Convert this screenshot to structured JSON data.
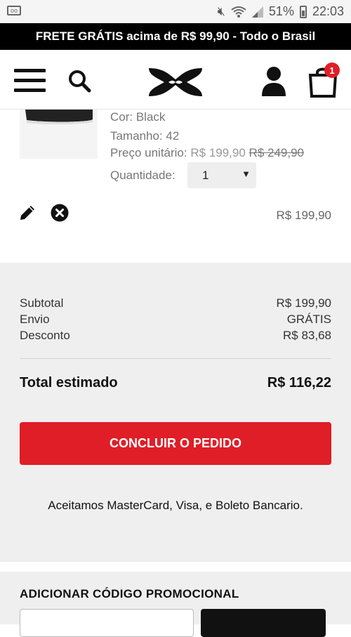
{
  "status_bar": {
    "battery_percent": "51%",
    "time": "22:03"
  },
  "promo_banner": {
    "text": "FRETE GRÁTIS acima de R$ 99,90 - Todo o Brasil"
  },
  "header": {
    "cart_count": "1"
  },
  "product": {
    "color": "Cor: Black",
    "size": "Tamanho: 42",
    "unit_price_label": "Preço unitário:",
    "unit_price": "R$ 199,90",
    "original_price": "R$ 249,90",
    "quantity_label": "Quantidade:",
    "quantity_value": "1",
    "line_total": "R$ 199,90"
  },
  "summary": {
    "subtotal_label": "Subtotal",
    "subtotal_value": "R$ 199,90",
    "shipping_label": "Envio",
    "shipping_value": "GRÁTIS",
    "discount_label": "Desconto",
    "discount_value": "R$ 83,68",
    "total_label": "Total estimado",
    "total_value": "R$ 116,22",
    "checkout_label": "CONCLUIR O PEDIDO",
    "payment_note": "Aceitamos MasterCard, Visa, e Boleto Bancario."
  },
  "promo_code": {
    "title": "ADICIONAR CÓDIGO PROMOCIONAL"
  },
  "colors": {
    "accent": "#e01e27",
    "banner_bg": "#000000",
    "summary_bg": "#efefef"
  }
}
